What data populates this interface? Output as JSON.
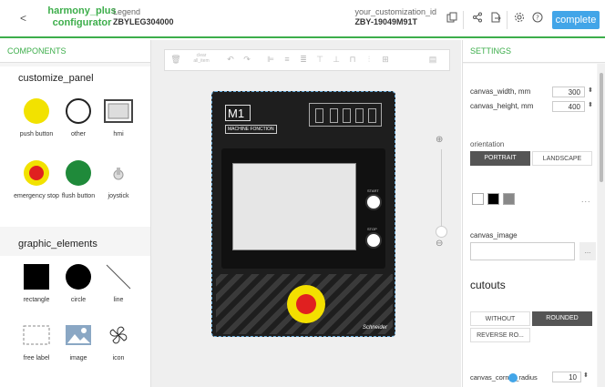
{
  "header": {
    "back_symbol": "<",
    "app_name": "harmony_plus configurator",
    "legend_title": "Legend",
    "legend_value": "ZBYLEG304000",
    "customization_title": "your_customization_id",
    "customization_value": "ZBY-19049M91T",
    "complete_label": "complete",
    "colors": {
      "accent": "#3dae4b",
      "button": "#42a5e8"
    }
  },
  "components_panel": {
    "title": "COMPONENTS",
    "customize_title": "customize_panel",
    "customize_items": [
      {
        "label": "push button",
        "icon": "yellow-circle"
      },
      {
        "label": "other",
        "icon": "white-circle"
      },
      {
        "label": "hmi",
        "icon": "hmi-screen"
      },
      {
        "label": "emergency stop",
        "icon": "emergency-stop"
      },
      {
        "label": "flush button",
        "icon": "green-circle"
      },
      {
        "label": "joystick",
        "icon": "joystick"
      }
    ],
    "graphic_title": "graphic_elements",
    "graphic_items": [
      {
        "label": "rectangle",
        "icon": "black-square"
      },
      {
        "label": "circle",
        "icon": "black-circle"
      },
      {
        "label": "line",
        "icon": "diagonal-line"
      },
      {
        "label": "free label",
        "icon": "dashed-box"
      },
      {
        "label": "image",
        "icon": "image"
      },
      {
        "label": "icon",
        "icon": "fan-icon"
      }
    ]
  },
  "toolbar": {
    "clear_label": "clear all_item"
  },
  "device": {
    "title": "M1",
    "function_label": "MACHINE FONCTION",
    "start_label": "START",
    "stop_label": "STOP",
    "brand": "Schneider"
  },
  "settings": {
    "title": "SETTINGS",
    "canvas_width_label": "canvas_width, mm",
    "canvas_width_value": "300",
    "canvas_height_label": "canvas_height, mm",
    "canvas_height_value": "400",
    "orientation_label": "orientation",
    "portrait_label": "PORTRAIT",
    "landscape_label": "LANDSCAPE",
    "canvas_image_label": "canvas_image",
    "more_label": "...",
    "cutouts_label": "cutouts",
    "without_label": "WITHOUT",
    "rounded_label": "ROUNDED",
    "reverse_label": "REVERSE RO...",
    "corner_radius_label": "canvas_corner_radius",
    "corner_radius_value": "10",
    "swatch_colors": [
      "#ffffff",
      "#000000",
      "#888888"
    ]
  }
}
